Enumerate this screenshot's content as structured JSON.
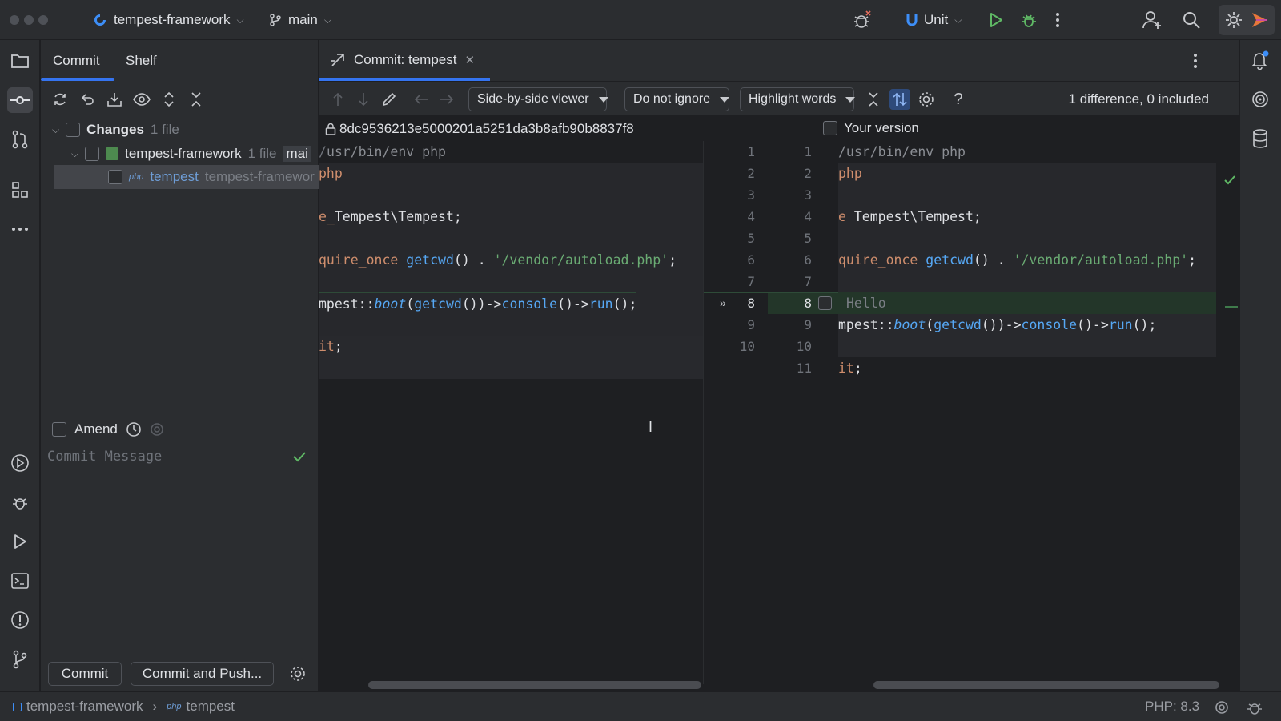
{
  "titlebar": {
    "project": "tempest-framework",
    "branch": "main",
    "run_config": "Unit",
    "colors": {
      "accent": "#3574f0",
      "run": "#5fb865"
    }
  },
  "commit_panel": {
    "tabs": [
      {
        "label": "Commit"
      },
      {
        "label": "Shelf"
      }
    ],
    "changes": {
      "label": "Changes",
      "count": "1 file"
    },
    "repo": {
      "label": "tempest-framework",
      "count": "1 file",
      "branch": "mai"
    },
    "file": {
      "badge": "php",
      "name": "tempest",
      "path": "tempest-framewor"
    },
    "amend_label": "Amend",
    "message_placeholder": "Commit Message",
    "commit_button": "Commit",
    "commit_push_button": "Commit and Push..."
  },
  "editor": {
    "tab_title": "Commit: tempest",
    "viewer_mode": "Side-by-side viewer",
    "ignore_mode": "Do not ignore",
    "highlight_mode": "Highlight words",
    "diff_summary": "1 difference, 0 included",
    "left_file": "8dc9536213e5000201a5251da3b8afb90b8837f8",
    "right_file": "Your version",
    "left_line_numbers": [
      "1",
      "2",
      "3",
      "4",
      "5",
      "6",
      "7",
      "8",
      "9",
      "10"
    ],
    "right_line_numbers": [
      "1",
      "2",
      "3",
      "4",
      "5",
      "6",
      "7",
      "8",
      "9",
      "10",
      "11"
    ],
    "code": {
      "shebang": "/usr/bin/env php",
      "shebang_left": "usr/bin/env php",
      "php": "php",
      "use_kw": "e",
      "use_ns": " Tempest\\Tempest;",
      "use_kw_left": "e_",
      "use_ns_left": "Tempest\\Tempest;",
      "req_kw": "quire_once",
      "req_fn": "getcwd",
      "req_mid": "() . ",
      "req_str": "'/vendor/autoload.php'",
      "semi": ";",
      "boot_cls": "mpest::",
      "boot_fn": "boot",
      "boot_p1": "(",
      "boot_getcwd": "getcwd",
      "boot_p2": "())->",
      "boot_console": "console",
      "boot_p3": "()->",
      "boot_run": "run",
      "boot_p4": "();",
      "exit_kw": "it",
      "added_line": "Hello"
    }
  },
  "statusbar": {
    "project": "tempest-framework",
    "file_badge": "php",
    "file": "tempest",
    "php_version": "PHP: 8.3"
  }
}
